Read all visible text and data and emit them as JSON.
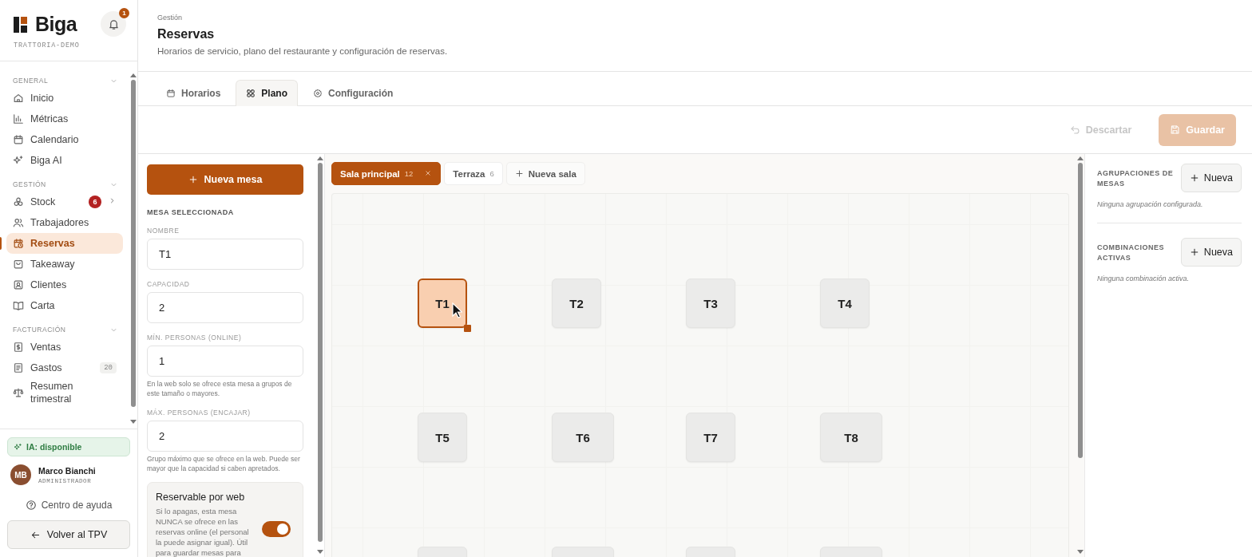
{
  "sidebar": {
    "brand": "Biga",
    "notifications": "1",
    "workspace": "TRATTORIA-DEMO",
    "sections": [
      {
        "title": "GENERAL",
        "expanded": true,
        "items": [
          {
            "label": "Inicio",
            "selected": false,
            "submenu": false
          },
          {
            "label": "Métricas",
            "selected": false,
            "submenu": false
          },
          {
            "label": "Calendario",
            "selected": false,
            "submenu": false
          },
          {
            "label": "Biga AI",
            "selected": false,
            "submenu": false
          }
        ]
      },
      {
        "title": "GESTIÓN",
        "expanded": true,
        "items": [
          {
            "label": "Stock",
            "selected": false,
            "submenu": true,
            "alert": "6"
          },
          {
            "label": "Trabajadores",
            "selected": false,
            "submenu": false
          },
          {
            "label": "Reservas",
            "selected": true,
            "submenu": false
          },
          {
            "label": "Takeaway",
            "selected": false,
            "submenu": false
          },
          {
            "label": "Clientes",
            "selected": false,
            "submenu": false
          },
          {
            "label": "Carta",
            "selected": false,
            "submenu": false
          }
        ]
      },
      {
        "title": "FACTURACIÓN",
        "expanded": true,
        "items": [
          {
            "label": "Ventas",
            "selected": false,
            "submenu": false
          },
          {
            "label": "Gastos",
            "selected": false,
            "submenu": false,
            "count": "20"
          },
          {
            "label": "Resumen trimestral",
            "selected": false,
            "submenu": false
          }
        ]
      }
    ],
    "ai_status": "IA: disponible",
    "user": {
      "initials": "MB",
      "name": "Marco Bianchi",
      "role": "ADMINISTRADOR"
    },
    "help": "Centro de ayuda",
    "back_button": "Volver al TPV"
  },
  "header": {
    "breadcrumb": "Gestión",
    "title": "Reservas",
    "subtitle": "Horarios de servicio, plano del restaurante y configuración de reservas."
  },
  "tabs": [
    {
      "label": "Horarios",
      "selected": false
    },
    {
      "label": "Plano",
      "selected": true
    },
    {
      "label": "Configuración",
      "selected": false
    }
  ],
  "actions": {
    "discard": {
      "label": "Descartar",
      "disabled": true
    },
    "save": {
      "label": "Guardar",
      "disabled": true
    }
  },
  "form": {
    "new_table_button": "Nueva mesa",
    "section_title": "MESA SELECCIONADA",
    "fields": [
      {
        "label": "NOMBRE",
        "value": "T1"
      },
      {
        "label": "CAPACIDAD",
        "value": "2"
      },
      {
        "label": "MÍN. PERSONAS (ONLINE)",
        "value": "1",
        "hint": "En la web solo se ofrece esta mesa a grupos de este tamaño o mayores."
      },
      {
        "label": "MÁX. PERSONAS (ENCAJAR)",
        "value": "2",
        "hint": "Grupo máximo que se ofrece en la web. Puede ser mayor que la capacidad si caben apretados."
      }
    ],
    "web_booking": {
      "title": "Reservable por web",
      "description": "Si lo apagas, esta mesa NUNCA se ofrece en las reservas online (el personal la puede asignar igual). Útil para guardar mesas para",
      "on": true
    }
  },
  "floor": {
    "rooms": [
      {
        "name": "Sala principal",
        "count": "12",
        "selected": true
      },
      {
        "name": "Terraza",
        "count": "6",
        "selected": false
      }
    ],
    "new_room_button": "Nueva sala",
    "table_rows": [
      [
        {
          "label": "T1",
          "kind": "square",
          "selected": true
        },
        {
          "label": "T2",
          "kind": "square",
          "selected": false
        },
        {
          "label": "T3",
          "kind": "square",
          "selected": false
        },
        {
          "label": "T4",
          "kind": "square",
          "selected": false
        }
      ],
      [
        {
          "label": "T5",
          "kind": "square",
          "selected": false
        },
        {
          "label": "T6",
          "kind": "wide",
          "selected": false
        },
        {
          "label": "T7",
          "kind": "square",
          "selected": false
        },
        {
          "label": "T8",
          "kind": "wide",
          "selected": false
        }
      ],
      [
        {
          "kind": "square",
          "selected": false
        },
        {
          "kind": "wide",
          "selected": false
        },
        {
          "kind": "square",
          "selected": false
        },
        {
          "kind": "wide",
          "selected": false
        }
      ]
    ]
  },
  "right_panel": {
    "groups": [
      {
        "title": "AGRUPACIONES DE MESAS",
        "button": "Nueva",
        "empty_text": "Ninguna agrupación configurada."
      },
      {
        "title": "COMBINACIONES ACTIVAS",
        "button": "Nueva",
        "empty_text": "Ninguna combinación activa."
      }
    ]
  }
}
